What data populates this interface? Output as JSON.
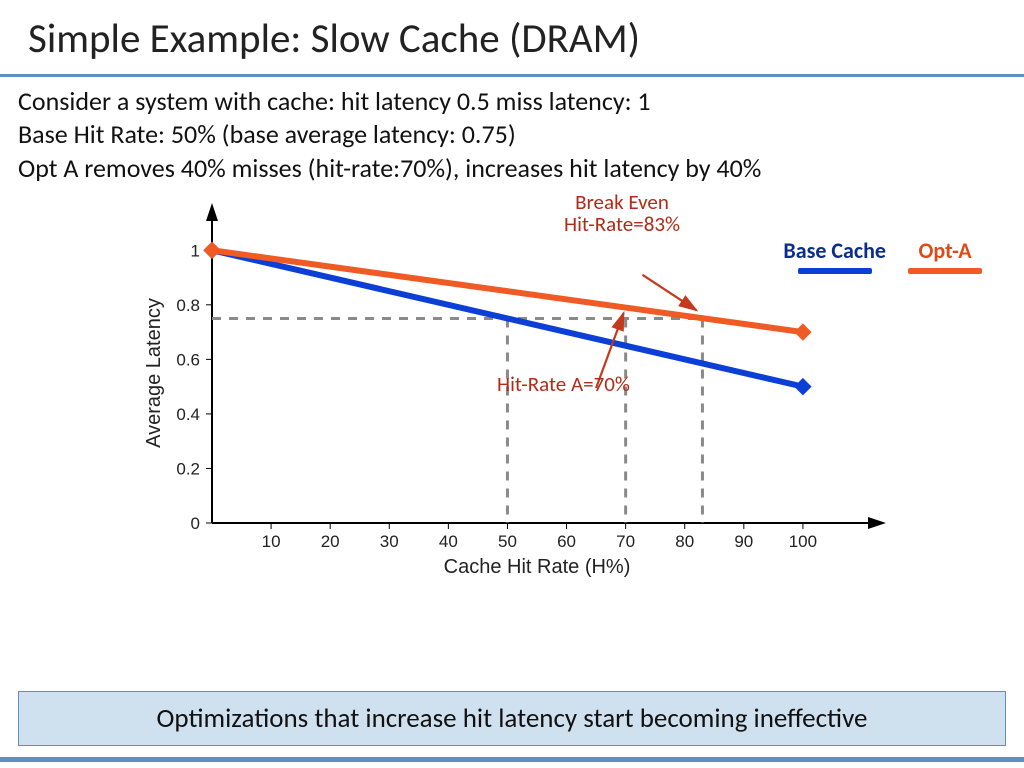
{
  "title": "Simple Example: Slow Cache (DRAM)",
  "body_line1": "Consider a system with cache:  hit latency 0.5  miss latency: 1",
  "body_line2": "Base Hit Rate: 50% (base average latency: 0.75)",
  "body_line3": "Opt A removes 40% misses (hit-rate:70%), increases hit latency by 40%",
  "legend": {
    "base": "Base Cache",
    "opta": "Opt-A"
  },
  "annotations": {
    "break_even_l1": "Break Even",
    "break_even_l2": "Hit-Rate=83%",
    "hit_rate_a": "Hit-Rate A=70%"
  },
  "footer": "Optimizations that increase hit latency start becoming ineffective",
  "chart_data": {
    "type": "line",
    "title": "",
    "xlabel": "Cache Hit Rate (H%)",
    "ylabel": "Average Latency",
    "xlim": [
      0,
      110
    ],
    "ylim": [
      0,
      1.1
    ],
    "xticks": [
      10,
      20,
      30,
      40,
      50,
      60,
      70,
      80,
      90,
      100
    ],
    "yticks": [
      0,
      0.2,
      0.4,
      0.6,
      0.8,
      1.0
    ],
    "series": [
      {
        "name": "Base Cache",
        "color": "#0b3fd6",
        "x": [
          0,
          100
        ],
        "y": [
          1.0,
          0.5
        ]
      },
      {
        "name": "Opt-A",
        "color": "#ef5a25",
        "x": [
          0,
          100
        ],
        "y": [
          1.0,
          0.7
        ]
      }
    ],
    "guides": {
      "h_latency_0_75": 0.75,
      "v_hit_50": 50,
      "v_hit_70": 70,
      "v_hit_83": 83
    },
    "markers": {
      "break_even_hit_rate": 83,
      "opt_a_hit_rate": 70
    }
  }
}
